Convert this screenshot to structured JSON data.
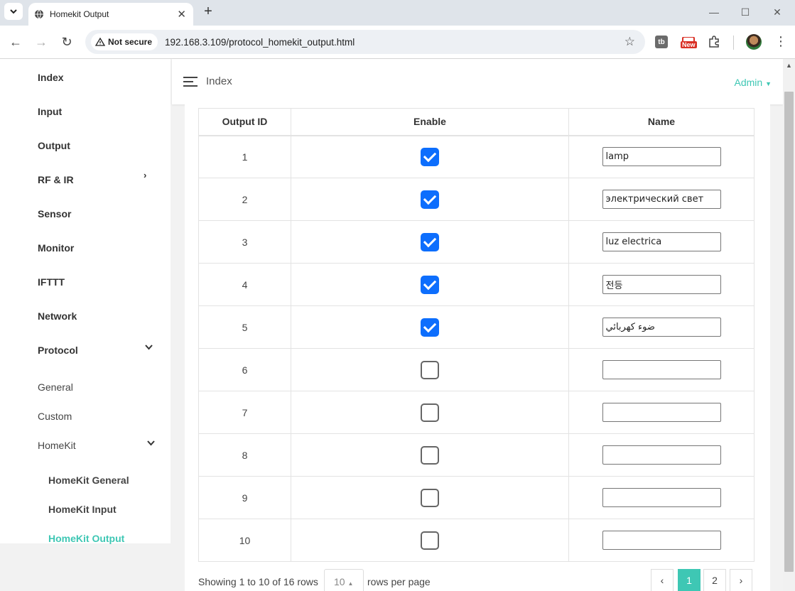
{
  "browser": {
    "tab_title": "Homekit Output",
    "not_secure_label": "Not secure",
    "url": "192.168.3.109/protocol_homekit_output.html",
    "new_badge": "New",
    "ext_label": "tb"
  },
  "sidebar": {
    "items": [
      {
        "label": "Index"
      },
      {
        "label": "Input"
      },
      {
        "label": "Output"
      },
      {
        "label": "RF & IR"
      },
      {
        "label": "Sensor"
      },
      {
        "label": "Monitor"
      },
      {
        "label": "IFTTT"
      },
      {
        "label": "Network"
      },
      {
        "label": "Protocol"
      }
    ],
    "protocol_sub": [
      {
        "label": "General"
      },
      {
        "label": "Custom"
      },
      {
        "label": "HomeKit"
      }
    ],
    "homekit_sub": [
      {
        "label": "HomeKit General"
      },
      {
        "label": "HomeKit Input"
      },
      {
        "label": "HomeKit Output",
        "active": true
      }
    ]
  },
  "header": {
    "title": "Index",
    "user": "Admin"
  },
  "table": {
    "columns": [
      "Output ID",
      "Enable",
      "Name"
    ],
    "rows": [
      {
        "id": "1",
        "enabled": true,
        "name": "lamp"
      },
      {
        "id": "2",
        "enabled": true,
        "name": "электрический свет"
      },
      {
        "id": "3",
        "enabled": true,
        "name": "luz electrica"
      },
      {
        "id": "4",
        "enabled": true,
        "name": "전등"
      },
      {
        "id": "5",
        "enabled": true,
        "name": "ضوء كهربائي"
      },
      {
        "id": "6",
        "enabled": false,
        "name": ""
      },
      {
        "id": "7",
        "enabled": false,
        "name": ""
      },
      {
        "id": "8",
        "enabled": false,
        "name": ""
      },
      {
        "id": "9",
        "enabled": false,
        "name": ""
      },
      {
        "id": "10",
        "enabled": false,
        "name": ""
      }
    ]
  },
  "pagination": {
    "showing_text": "Showing 1 to 10 of 16 rows",
    "page_size": "10",
    "rows_per_page_text": "rows per page",
    "prev": "‹",
    "pages": [
      "1",
      "2"
    ],
    "current_page": "1",
    "next": "›"
  }
}
